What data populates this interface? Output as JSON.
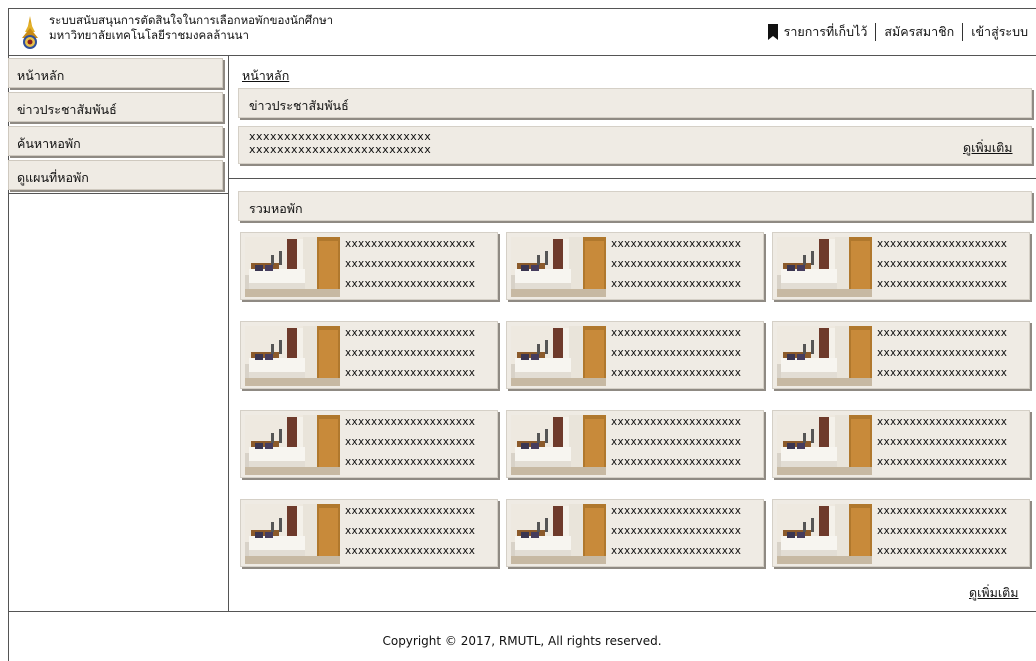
{
  "header": {
    "title_line1": "ระบบสนับสนุนการตัดสินใจในการเลือกหอพักของนักศึกษา",
    "title_line2": "มหาวิทยาลัยเทคโนโลยีราชมงคลล้านนา",
    "nav": {
      "saved": "รายการที่เก็บไว้",
      "register": "สมัครสมาชิก",
      "login": "เข้าสู่ระบบ"
    }
  },
  "sidebar": {
    "items": [
      {
        "label": "หน้าหลัก"
      },
      {
        "label": "ข่าวประชาสัมพันธ์"
      },
      {
        "label": "ค้นหาหอพัก"
      },
      {
        "label": "ดูแผนที่หอพัก"
      }
    ]
  },
  "main": {
    "breadcrumb": "หน้าหลัก",
    "news": {
      "heading": "ข่าวประชาสัมพันธ์",
      "line1": "xxxxxxxxxxxxxxxxxxxxxxxxxx",
      "line2": "xxxxxxxxxxxxxxxxxxxxxxxxxx",
      "more": "ดูเพิ่มเติม"
    },
    "dorms": {
      "heading": "รวมหอพัก",
      "more": "ดูเพิ่มเติม",
      "cards": [
        {
          "l1": "xxxxxxxxxxxxxxxxxxxx",
          "l2": "xxxxxxxxxxxxxxxxxxxx",
          "l3": "xxxxxxxxxxxxxxxxxxxx"
        },
        {
          "l1": "xxxxxxxxxxxxxxxxxxxx",
          "l2": "xxxxxxxxxxxxxxxxxxxx",
          "l3": "xxxxxxxxxxxxxxxxxxxx"
        },
        {
          "l1": "xxxxxxxxxxxxxxxxxxxx",
          "l2": "xxxxxxxxxxxxxxxxxxxx",
          "l3": "xxxxxxxxxxxxxxxxxxxx"
        },
        {
          "l1": "xxxxxxxxxxxxxxxxxxxx",
          "l2": "xxxxxxxxxxxxxxxxxxxx",
          "l3": "xxxxxxxxxxxxxxxxxxxx"
        },
        {
          "l1": "xxxxxxxxxxxxxxxxxxxx",
          "l2": "xxxxxxxxxxxxxxxxxxxx",
          "l3": "xxxxxxxxxxxxxxxxxxxx"
        },
        {
          "l1": "xxxxxxxxxxxxxxxxxxxx",
          "l2": "xxxxxxxxxxxxxxxxxxxx",
          "l3": "xxxxxxxxxxxxxxxxxxxx"
        },
        {
          "l1": "xxxxxxxxxxxxxxxxxxxx",
          "l2": "xxxxxxxxxxxxxxxxxxxx",
          "l3": "xxxxxxxxxxxxxxxxxxxx"
        },
        {
          "l1": "xxxxxxxxxxxxxxxxxxxx",
          "l2": "xxxxxxxxxxxxxxxxxxxx",
          "l3": "xxxxxxxxxxxxxxxxxxxx"
        },
        {
          "l1": "xxxxxxxxxxxxxxxxxxxx",
          "l2": "xxxxxxxxxxxxxxxxxxxx",
          "l3": "xxxxxxxxxxxxxxxxxxxx"
        },
        {
          "l1": "xxxxxxxxxxxxxxxxxxxx",
          "l2": "xxxxxxxxxxxxxxxxxxxx",
          "l3": "xxxxxxxxxxxxxxxxxxxx"
        },
        {
          "l1": "xxxxxxxxxxxxxxxxxxxx",
          "l2": "xxxxxxxxxxxxxxxxxxxx",
          "l3": "xxxxxxxxxxxxxxxxxxxx"
        },
        {
          "l1": "xxxxxxxxxxxxxxxxxxxx",
          "l2": "xxxxxxxxxxxxxxxxxxxx",
          "l3": "xxxxxxxxxxxxxxxxxxxx"
        }
      ]
    }
  },
  "footer": {
    "copyright": "Copyright © 2017, RMUTL, All rights reserved."
  },
  "colors": {
    "panel_bg": "#efebe4",
    "shadow": "#8f8a83",
    "border": "#555555"
  },
  "icons": {
    "logo": "university-seal-icon",
    "bookmark": "bookmark-icon",
    "dorm_photo": "bedroom-photo-icon"
  }
}
